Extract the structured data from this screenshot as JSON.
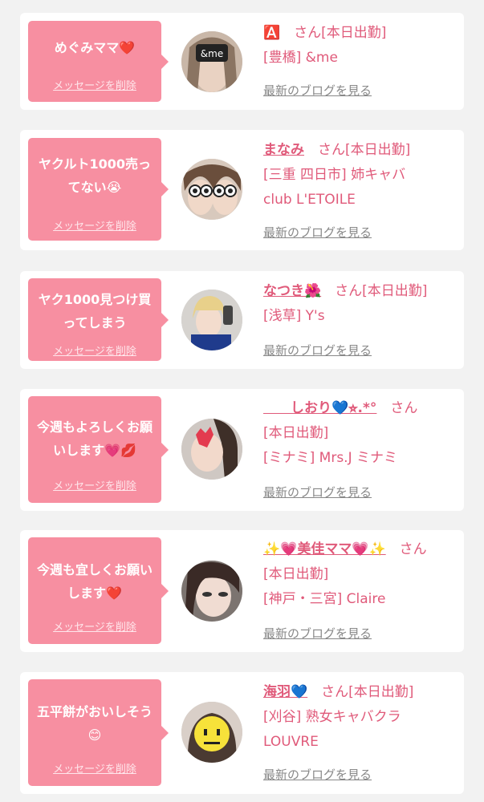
{
  "delete_label": "メッセージを削除",
  "blog_label": "最新のブログを見る",
  "cards": [
    {
      "message": "めぐみママ❤️",
      "name": "🅰️",
      "suffix": "さん[本日出勤]",
      "lines": [
        "[豊橋] &me"
      ]
    },
    {
      "message": "ヤクルト1000売ってない😭",
      "name": "まなみ",
      "suffix": "さん[本日出勤]",
      "lines": [
        "[三重 四日市] 姉キャバ",
        "club L'ETOILE"
      ]
    },
    {
      "message": "ヤク1000見つけ買ってしまう",
      "name": "なつき🌺",
      "suffix": "さん[本日出勤]",
      "lines": [
        "[浅草] Y's"
      ]
    },
    {
      "message": "今週もよろしくお願いします💗💋",
      "name": "　　しおり💙⭐︎.*°",
      "suffix": "さん",
      "lines": [
        "[本日出勤]",
        "[ミナミ] Mrs.J ミナミ"
      ]
    },
    {
      "message": "今週も宜しくお願いします❤️",
      "name": "✨💗美佳ママ💗✨",
      "suffix": "さん",
      "lines": [
        "[本日出勤]",
        "[神戸・三宮] Claire"
      ]
    },
    {
      "message": "五平餅がおいしそう😊",
      "name": "海羽💙",
      "suffix": "さん[本日出勤]",
      "lines": [
        "[刈谷] 熟女キャバクラ",
        "LOUVRE"
      ]
    }
  ],
  "colors": {
    "accent": "#f78fa1",
    "name": "#e05a7a",
    "background": "#f2f2f2"
  }
}
